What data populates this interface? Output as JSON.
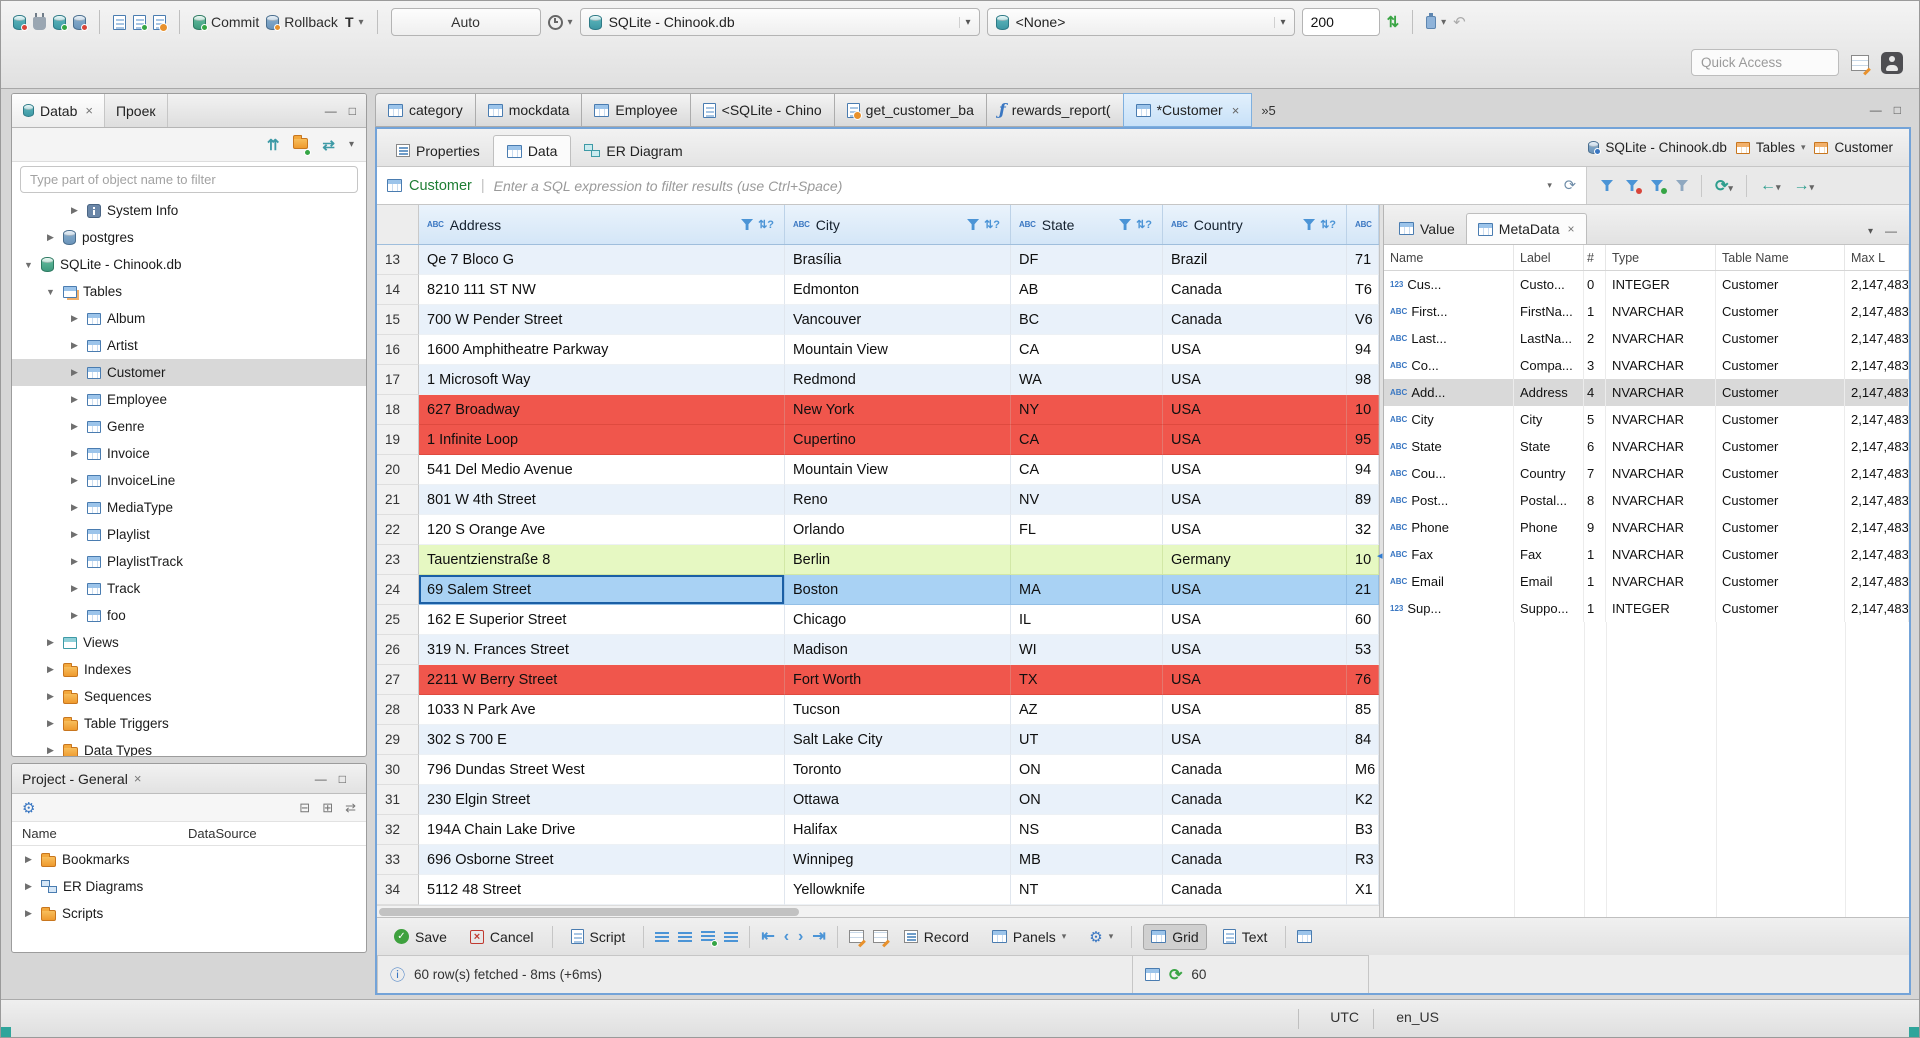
{
  "icons": {
    "abc": "ABC",
    "num": "123",
    "caret": "▾",
    "close": "×",
    "check": "✓",
    "cross": "×",
    "info": "ⓘ",
    "refresh": "⟳",
    "sort": "⇅?",
    "link": "⇄",
    "collapse": "⇈",
    "gear": "⚙",
    "min": "—",
    "max": "□",
    "first": "⇤",
    "prev": "‹",
    "next": "›",
    "last": "⇥",
    "back": "←",
    "fwd": "→",
    "updown": "⇅",
    "undo": "↶",
    "pipe": "|",
    "splitter": "◂",
    "box_plus": "⊞",
    "box_minus": "⊟"
  },
  "toolbar": {
    "commit_label": "Commit",
    "rollback_label": "Rollback",
    "txn_letter": "T",
    "auto_label": "Auto",
    "connection_value": "SQLite - Chinook.db",
    "schema_value": "<None>",
    "fetch_size_value": "200",
    "quick_access_placeholder": "Quick Access"
  },
  "nav": {
    "tab_db": "Datab",
    "tab_project": "Проек",
    "filter_placeholder": "Type part of object name to filter",
    "tree": [
      {
        "label": "System Info",
        "cls": "lvl2",
        "icon": "ic-sysinfo",
        "arrow": "▶"
      },
      {
        "label": "postgres",
        "cls": "lvl1",
        "icon": "cyl",
        "arrow": "▶"
      },
      {
        "label": "SQLite - Chinook.db",
        "cls": "lvl0",
        "icon": "cyl green",
        "arrow": "▼"
      },
      {
        "label": "Tables",
        "cls": "lvl1",
        "icon": "ic-tables",
        "arrow": "▼"
      },
      {
        "label": "Album",
        "cls": "lvl2",
        "icon": "ic-table",
        "arrow": "▶"
      },
      {
        "label": "Artist",
        "cls": "lvl2",
        "icon": "ic-table",
        "arrow": "▶"
      },
      {
        "label": "Customer",
        "cls": "lvl2 selected",
        "icon": "ic-table",
        "arrow": "▶"
      },
      {
        "label": "Employee",
        "cls": "lvl2",
        "icon": "ic-table",
        "arrow": "▶"
      },
      {
        "label": "Genre",
        "cls": "lvl2",
        "icon": "ic-table",
        "arrow": "▶"
      },
      {
        "label": "Invoice",
        "cls": "lvl2",
        "icon": "ic-table",
        "arrow": "▶"
      },
      {
        "label": "InvoiceLine",
        "cls": "lvl2",
        "icon": "ic-table",
        "arrow": "▶"
      },
      {
        "label": "MediaType",
        "cls": "lvl2",
        "icon": "ic-table",
        "arrow": "▶"
      },
      {
        "label": "Playlist",
        "cls": "lvl2",
        "icon": "ic-table",
        "arrow": "▶"
      },
      {
        "label": "PlaylistTrack",
        "cls": "lvl2",
        "icon": "ic-table",
        "arrow": "▶"
      },
      {
        "label": "Track",
        "cls": "lvl2",
        "icon": "ic-table",
        "arrow": "▶"
      },
      {
        "label": "foo",
        "cls": "lvl2",
        "icon": "ic-table",
        "arrow": "▶"
      },
      {
        "label": "Views",
        "cls": "lvl1",
        "icon": "ic-views",
        "arrow": "▶"
      },
      {
        "label": "Indexes",
        "cls": "lvl1",
        "icon": "ic-folder",
        "arrow": "▶"
      },
      {
        "label": "Sequences",
        "cls": "lvl1",
        "icon": "ic-folder",
        "arrow": "▶"
      },
      {
        "label": "Table Triggers",
        "cls": "lvl1",
        "icon": "ic-folder",
        "arrow": "▶"
      },
      {
        "label": "Data Types",
        "cls": "lvl1",
        "icon": "ic-folder",
        "arrow": "▶"
      }
    ]
  },
  "project": {
    "title": "Project - General",
    "col_name": "Name",
    "col_datasource": "DataSource",
    "items": [
      {
        "label": "Bookmarks",
        "icon": "ic-folder",
        "arrow": "▶"
      },
      {
        "label": "ER Diagrams",
        "icon": "ic-er",
        "arrow": "▶"
      },
      {
        "label": "Scripts",
        "icon": "ic-folder",
        "arrow": "▶"
      }
    ]
  },
  "editor": {
    "tabs": [
      {
        "label": "category",
        "icon": "ic-ttab"
      },
      {
        "label": "mockdata",
        "icon": "ic-ttab"
      },
      {
        "label": "Employee",
        "icon": "ic-ttab"
      },
      {
        "label": "<SQLite - Chino",
        "icon": "ic-sql"
      },
      {
        "label": "get_customer_ba",
        "icon": "ic-sqlo"
      },
      {
        "label": "rewards_report(",
        "icon": "ic-func",
        "glyph": "ƒ"
      },
      {
        "label": "*Customer",
        "icon": "ic-ttab",
        "cls": "active",
        "close": "×"
      }
    ],
    "overflow": "»5",
    "subtabs": [
      {
        "label": "Properties",
        "icon": "ic-props"
      },
      {
        "label": "Data",
        "icon": "ic-data",
        "cls": "active"
      },
      {
        "label": "ER Diagram",
        "icon": "ic-erd"
      }
    ],
    "ctx_db": "SQLite - Chinook.db",
    "ctx_tables": "Tables",
    "ctx_entity": "Customer",
    "filter_entity": "Customer",
    "filter_placeholder": "Enter a SQL expression to filter results (use Ctrl+Space)"
  },
  "grid": {
    "headers": [
      "Address",
      "City",
      "State",
      "Country"
    ],
    "rows": [
      {
        "num": "13",
        "address": "Qe 7 Bloco G",
        "city": "Brasília",
        "state": "DF",
        "country": "Brazil",
        "extra": "71",
        "cls": "alt"
      },
      {
        "num": "14",
        "address": "8210 111 ST NW",
        "city": "Edmonton",
        "state": "AB",
        "country": "Canada",
        "extra": "T6",
        "cls": "plain"
      },
      {
        "num": "15",
        "address": "700 W Pender Street",
        "city": "Vancouver",
        "state": "BC",
        "country": "Canada",
        "extra": "V6",
        "cls": "alt"
      },
      {
        "num": "16",
        "address": "1600 Amphitheatre Parkway",
        "city": "Mountain View",
        "state": "CA",
        "country": "USA",
        "extra": "94",
        "cls": "plain"
      },
      {
        "num": "17",
        "address": "1 Microsoft Way",
        "city": "Redmond",
        "state": "WA",
        "country": "USA",
        "extra": "98",
        "cls": "alt"
      },
      {
        "num": "18",
        "address": "627 Broadway",
        "city": "New York",
        "state": "NY",
        "country": "USA",
        "extra": "10",
        "cls": "red"
      },
      {
        "num": "19",
        "address": "1 Infinite Loop",
        "city": "Cupertino",
        "state": "CA",
        "country": "USA",
        "extra": "95",
        "cls": "red"
      },
      {
        "num": "20",
        "address": "541 Del Medio Avenue",
        "city": "Mountain View",
        "state": "CA",
        "country": "USA",
        "extra": "94",
        "cls": "plain"
      },
      {
        "num": "21",
        "address": "801 W 4th Street",
        "city": "Reno",
        "state": "NV",
        "country": "USA",
        "extra": "89",
        "cls": "alt"
      },
      {
        "num": "22",
        "address": "120 S Orange Ave",
        "city": "Orlando",
        "state": "FL",
        "country": "USA",
        "extra": "32",
        "cls": "plain"
      },
      {
        "num": "23",
        "address": "Tauentzienstraße 8",
        "city": "Berlin",
        "state": "",
        "country": "Germany",
        "extra": "10",
        "cls": "green"
      },
      {
        "num": "24",
        "address": "69 Salem Street",
        "city": "Boston",
        "state": "MA",
        "country": "USA",
        "extra": "21",
        "cls": "sel"
      },
      {
        "num": "25",
        "address": "162 E Superior Street",
        "city": "Chicago",
        "state": "IL",
        "country": "USA",
        "extra": "60",
        "cls": "plain"
      },
      {
        "num": "26",
        "address": "319 N. Frances Street",
        "city": "Madison",
        "state": "WI",
        "country": "USA",
        "extra": "53",
        "cls": "alt"
      },
      {
        "num": "27",
        "address": "2211 W Berry Street",
        "city": "Fort Worth",
        "state": "TX",
        "country": "USA",
        "extra": "76",
        "cls": "red"
      },
      {
        "num": "28",
        "address": "1033 N Park Ave",
        "city": "Tucson",
        "state": "AZ",
        "country": "USA",
        "extra": "85",
        "cls": "plain"
      },
      {
        "num": "29",
        "address": "302 S 700 E",
        "city": "Salt Lake City",
        "state": "UT",
        "country": "USA",
        "extra": "84",
        "cls": "alt"
      },
      {
        "num": "30",
        "address": "796 Dundas Street West",
        "city": "Toronto",
        "state": "ON",
        "country": "Canada",
        "extra": "M6",
        "cls": "plain"
      },
      {
        "num": "31",
        "address": "230 Elgin Street",
        "city": "Ottawa",
        "state": "ON",
        "country": "Canada",
        "extra": "K2",
        "cls": "alt"
      },
      {
        "num": "32",
        "address": "194A Chain Lake Drive",
        "city": "Halifax",
        "state": "NS",
        "country": "Canada",
        "extra": "B3",
        "cls": "plain"
      },
      {
        "num": "33",
        "address": "696 Osborne Street",
        "city": "Winnipeg",
        "state": "MB",
        "country": "Canada",
        "extra": "R3",
        "cls": "alt"
      },
      {
        "num": "34",
        "address": "5112 48 Street",
        "city": "Yellowknife",
        "state": "NT",
        "country": "Canada",
        "extra": "X1",
        "cls": "plain"
      }
    ]
  },
  "meta": {
    "tab_value": "Value",
    "tab_meta": "MetaData",
    "headers": [
      "Name",
      "Label",
      "#",
      "Type",
      "Table Name",
      "Max L"
    ],
    "rows": [
      {
        "icon": "123",
        "name": "Cus...",
        "label": "Custo...",
        "num": "0",
        "type": "INTEGER",
        "table": "Customer",
        "max": "2,147,483"
      },
      {
        "icon": "ABC",
        "name": "First...",
        "label": "FirstNa...",
        "num": "1",
        "type": "NVARCHAR",
        "table": "Customer",
        "max": "2,147,483"
      },
      {
        "icon": "ABC",
        "name": "Last...",
        "label": "LastNa...",
        "num": "2",
        "type": "NVARCHAR",
        "table": "Customer",
        "max": "2,147,483"
      },
      {
        "icon": "ABC",
        "name": "Co...",
        "label": "Compa...",
        "num": "3",
        "type": "NVARCHAR",
        "table": "Customer",
        "max": "2,147,483"
      },
      {
        "icon": "ABC",
        "name": "Add...",
        "label": "Address",
        "num": "4",
        "type": "NVARCHAR",
        "table": "Customer",
        "max": "2,147,483",
        "cls": "msel"
      },
      {
        "icon": "ABC",
        "name": "City",
        "label": "City",
        "num": "5",
        "type": "NVARCHAR",
        "table": "Customer",
        "max": "2,147,483"
      },
      {
        "icon": "ABC",
        "name": "State",
        "label": "State",
        "num": "6",
        "type": "NVARCHAR",
        "table": "Customer",
        "max": "2,147,483"
      },
      {
        "icon": "ABC",
        "name": "Cou...",
        "label": "Country",
        "num": "7",
        "type": "NVARCHAR",
        "table": "Customer",
        "max": "2,147,483"
      },
      {
        "icon": "ABC",
        "name": "Post...",
        "label": "Postal...",
        "num": "8",
        "type": "NVARCHAR",
        "table": "Customer",
        "max": "2,147,483"
      },
      {
        "icon": "ABC",
        "name": "Phone",
        "label": "Phone",
        "num": "9",
        "type": "NVARCHAR",
        "table": "Customer",
        "max": "2,147,483"
      },
      {
        "icon": "ABC",
        "name": "Fax",
        "label": "Fax",
        "num": "1",
        "type": "NVARCHAR",
        "table": "Customer",
        "max": "2,147,483"
      },
      {
        "icon": "ABC",
        "name": "Email",
        "label": "Email",
        "num": "1",
        "type": "NVARCHAR",
        "table": "Customer",
        "max": "2,147,483"
      },
      {
        "icon": "123",
        "name": "Sup...",
        "label": "Suppo...",
        "num": "1",
        "type": "INTEGER",
        "table": "Customer",
        "max": "2,147,483"
      }
    ]
  },
  "footer": {
    "save": "Save",
    "cancel": "Cancel",
    "script": "Script",
    "record": "Record",
    "panels": "Panels",
    "grid": "Grid",
    "text": "Text"
  },
  "status": {
    "fetched": "60 row(s) fetched - 8ms (+6ms)",
    "count": "60"
  },
  "winstatus": {
    "tz": "UTC",
    "locale": "en_US"
  }
}
